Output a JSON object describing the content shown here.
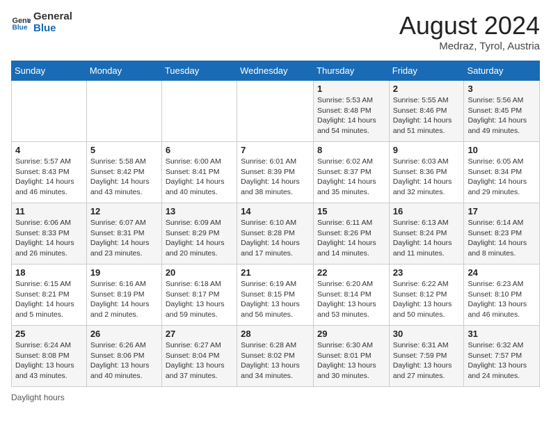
{
  "header": {
    "logo_line1": "General",
    "logo_line2": "Blue",
    "month_year": "August 2024",
    "location": "Medraz, Tyrol, Austria"
  },
  "footer": {
    "daylight_label": "Daylight hours"
  },
  "weekdays": [
    "Sunday",
    "Monday",
    "Tuesday",
    "Wednesday",
    "Thursday",
    "Friday",
    "Saturday"
  ],
  "weeks": [
    [
      {
        "day": "",
        "info": ""
      },
      {
        "day": "",
        "info": ""
      },
      {
        "day": "",
        "info": ""
      },
      {
        "day": "",
        "info": ""
      },
      {
        "day": "1",
        "info": "Sunrise: 5:53 AM\nSunset: 8:48 PM\nDaylight: 14 hours and 54 minutes."
      },
      {
        "day": "2",
        "info": "Sunrise: 5:55 AM\nSunset: 8:46 PM\nDaylight: 14 hours and 51 minutes."
      },
      {
        "day": "3",
        "info": "Sunrise: 5:56 AM\nSunset: 8:45 PM\nDaylight: 14 hours and 49 minutes."
      }
    ],
    [
      {
        "day": "4",
        "info": "Sunrise: 5:57 AM\nSunset: 8:43 PM\nDaylight: 14 hours and 46 minutes."
      },
      {
        "day": "5",
        "info": "Sunrise: 5:58 AM\nSunset: 8:42 PM\nDaylight: 14 hours and 43 minutes."
      },
      {
        "day": "6",
        "info": "Sunrise: 6:00 AM\nSunset: 8:41 PM\nDaylight: 14 hours and 40 minutes."
      },
      {
        "day": "7",
        "info": "Sunrise: 6:01 AM\nSunset: 8:39 PM\nDaylight: 14 hours and 38 minutes."
      },
      {
        "day": "8",
        "info": "Sunrise: 6:02 AM\nSunset: 8:37 PM\nDaylight: 14 hours and 35 minutes."
      },
      {
        "day": "9",
        "info": "Sunrise: 6:03 AM\nSunset: 8:36 PM\nDaylight: 14 hours and 32 minutes."
      },
      {
        "day": "10",
        "info": "Sunrise: 6:05 AM\nSunset: 8:34 PM\nDaylight: 14 hours and 29 minutes."
      }
    ],
    [
      {
        "day": "11",
        "info": "Sunrise: 6:06 AM\nSunset: 8:33 PM\nDaylight: 14 hours and 26 minutes."
      },
      {
        "day": "12",
        "info": "Sunrise: 6:07 AM\nSunset: 8:31 PM\nDaylight: 14 hours and 23 minutes."
      },
      {
        "day": "13",
        "info": "Sunrise: 6:09 AM\nSunset: 8:29 PM\nDaylight: 14 hours and 20 minutes."
      },
      {
        "day": "14",
        "info": "Sunrise: 6:10 AM\nSunset: 8:28 PM\nDaylight: 14 hours and 17 minutes."
      },
      {
        "day": "15",
        "info": "Sunrise: 6:11 AM\nSunset: 8:26 PM\nDaylight: 14 hours and 14 minutes."
      },
      {
        "day": "16",
        "info": "Sunrise: 6:13 AM\nSunset: 8:24 PM\nDaylight: 14 hours and 11 minutes."
      },
      {
        "day": "17",
        "info": "Sunrise: 6:14 AM\nSunset: 8:23 PM\nDaylight: 14 hours and 8 minutes."
      }
    ],
    [
      {
        "day": "18",
        "info": "Sunrise: 6:15 AM\nSunset: 8:21 PM\nDaylight: 14 hours and 5 minutes."
      },
      {
        "day": "19",
        "info": "Sunrise: 6:16 AM\nSunset: 8:19 PM\nDaylight: 14 hours and 2 minutes."
      },
      {
        "day": "20",
        "info": "Sunrise: 6:18 AM\nSunset: 8:17 PM\nDaylight: 13 hours and 59 minutes."
      },
      {
        "day": "21",
        "info": "Sunrise: 6:19 AM\nSunset: 8:15 PM\nDaylight: 13 hours and 56 minutes."
      },
      {
        "day": "22",
        "info": "Sunrise: 6:20 AM\nSunset: 8:14 PM\nDaylight: 13 hours and 53 minutes."
      },
      {
        "day": "23",
        "info": "Sunrise: 6:22 AM\nSunset: 8:12 PM\nDaylight: 13 hours and 50 minutes."
      },
      {
        "day": "24",
        "info": "Sunrise: 6:23 AM\nSunset: 8:10 PM\nDaylight: 13 hours and 46 minutes."
      }
    ],
    [
      {
        "day": "25",
        "info": "Sunrise: 6:24 AM\nSunset: 8:08 PM\nDaylight: 13 hours and 43 minutes."
      },
      {
        "day": "26",
        "info": "Sunrise: 6:26 AM\nSunset: 8:06 PM\nDaylight: 13 hours and 40 minutes."
      },
      {
        "day": "27",
        "info": "Sunrise: 6:27 AM\nSunset: 8:04 PM\nDaylight: 13 hours and 37 minutes."
      },
      {
        "day": "28",
        "info": "Sunrise: 6:28 AM\nSunset: 8:02 PM\nDaylight: 13 hours and 34 minutes."
      },
      {
        "day": "29",
        "info": "Sunrise: 6:30 AM\nSunset: 8:01 PM\nDaylight: 13 hours and 30 minutes."
      },
      {
        "day": "30",
        "info": "Sunrise: 6:31 AM\nSunset: 7:59 PM\nDaylight: 13 hours and 27 minutes."
      },
      {
        "day": "31",
        "info": "Sunrise: 6:32 AM\nSunset: 7:57 PM\nDaylight: 13 hours and 24 minutes."
      }
    ]
  ]
}
